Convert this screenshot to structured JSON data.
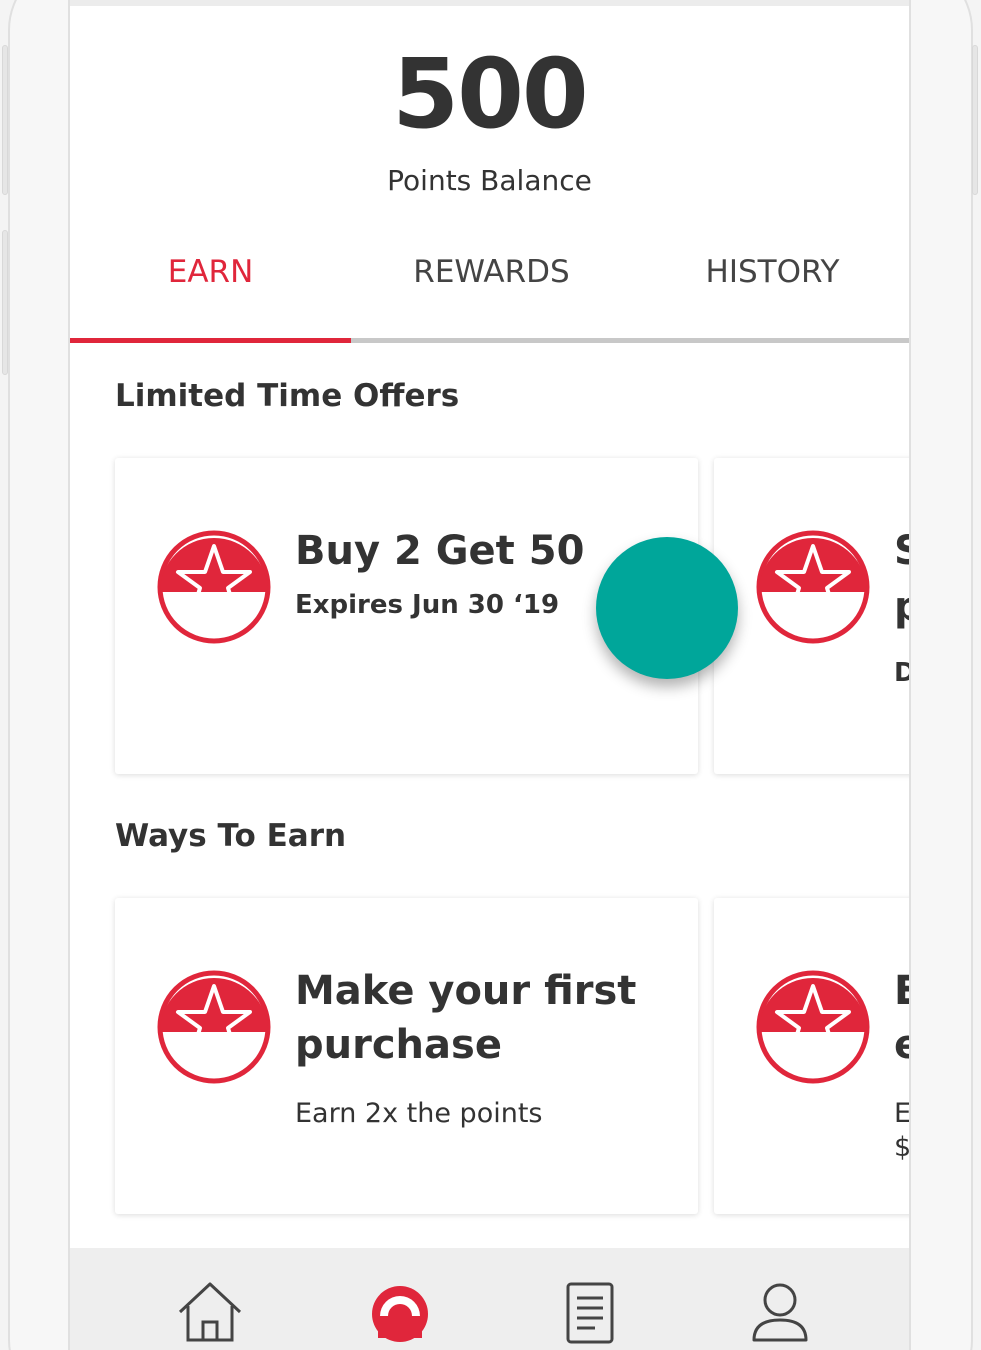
{
  "balance": {
    "value": "500",
    "label": "Points Balance"
  },
  "tabs": [
    {
      "label": "EARN",
      "active": true
    },
    {
      "label": "REWARDS",
      "active": false
    },
    {
      "label": "HISTORY",
      "active": false
    }
  ],
  "limited_offers": {
    "title": "Limited Time Offers",
    "cards": [
      {
        "title": "Buy 2 Get 50",
        "subtitle": "Expires Jun 30 ‘19",
        "icon": "star-badge-icon"
      },
      {
        "title_line1": "S",
        "title_line2": "p",
        "subtitle": "D",
        "icon": "star-badge-icon"
      }
    ]
  },
  "ways_to_earn": {
    "title": "Ways To Earn",
    "cards": [
      {
        "title_line1": "Make your first",
        "title_line2": "purchase",
        "subtitle": "Earn 2x the points",
        "icon": "star-badge-icon"
      },
      {
        "title_line1": "E",
        "title_line2": "e",
        "subtitle_line1": "E",
        "subtitle_line2": "$",
        "icon": "star-badge-icon"
      }
    ]
  },
  "bottom_nav": [
    {
      "icon": "home-icon"
    },
    {
      "icon": "rewards-badge-icon",
      "active": true
    },
    {
      "icon": "receipt-icon"
    },
    {
      "icon": "profile-icon"
    }
  ],
  "colors": {
    "accent": "#e0263b",
    "fab": "#00a69a",
    "text": "#333333"
  }
}
